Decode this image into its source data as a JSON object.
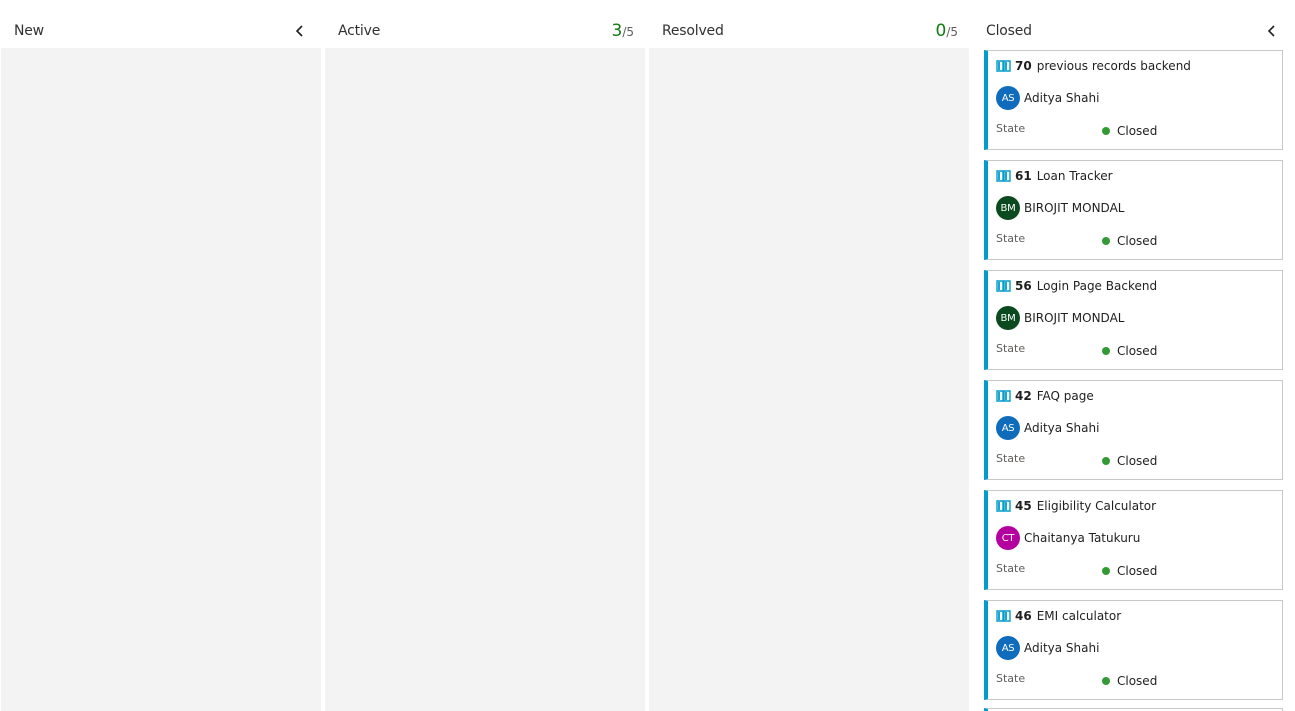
{
  "columns": [
    {
      "title": "New"
    },
    {
      "title": "Active",
      "wip_count": "3",
      "wip_limit": "/5"
    },
    {
      "title": "Resolved",
      "wip_count": "0",
      "wip_limit": "/5"
    },
    {
      "title": "Closed"
    }
  ],
  "state_label": "State",
  "colors": {
    "accent": "#009ccc",
    "wip_ok": "#107c10",
    "closed_dot": "#339933",
    "column_bg": "#f3f3f3"
  },
  "cards": [
    {
      "id": "70",
      "title": "previous records backend",
      "assignee": "Aditya Shahi",
      "initials": "AS",
      "avatar_color": "#0f6cbd",
      "state": "Closed",
      "icon": "book-icon"
    },
    {
      "id": "61",
      "title": "Loan Tracker",
      "assignee": "BIROJIT MONDAL",
      "initials": "BM",
      "avatar_color": "#0b4a1f",
      "state": "Closed",
      "icon": "book-icon"
    },
    {
      "id": "56",
      "title": "Login Page Backend",
      "assignee": "BIROJIT MONDAL",
      "initials": "BM",
      "avatar_color": "#0b4a1f",
      "state": "Closed",
      "icon": "book-icon"
    },
    {
      "id": "42",
      "title": "FAQ page",
      "assignee": "Aditya Shahi",
      "initials": "AS",
      "avatar_color": "#0f6cbd",
      "state": "Closed",
      "icon": "book-icon"
    },
    {
      "id": "45",
      "title": "Eligibility Calculator",
      "assignee": "Chaitanya Tatukuru",
      "initials": "CT",
      "avatar_color": "#b4009e",
      "state": "Closed",
      "icon": "book-icon"
    },
    {
      "id": "46",
      "title": "EMI calculator",
      "assignee": "Aditya Shahi",
      "initials": "AS",
      "avatar_color": "#0f6cbd",
      "state": "Closed",
      "icon": "book-icon"
    }
  ]
}
